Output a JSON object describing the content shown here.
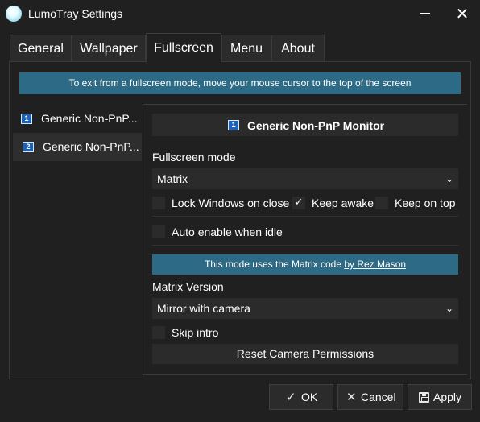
{
  "window": {
    "title": "LumoTray Settings"
  },
  "tabs": [
    {
      "label": "General"
    },
    {
      "label": "Wallpaper"
    },
    {
      "label": "Fullscreen",
      "active": true
    },
    {
      "label": "Menu"
    },
    {
      "label": "About"
    }
  ],
  "info_banner": "To exit from a fullscreen mode, move your mouse cursor to the top of the screen",
  "monitors": [
    {
      "number": "1",
      "label": "Generic Non-PnP..."
    },
    {
      "number": "2",
      "label": "Generic Non-PnP...",
      "selected": true
    }
  ],
  "detail": {
    "monitor_number": "1",
    "title": "Generic Non-PnP Monitor",
    "fullscreen_mode_label": "Fullscreen mode",
    "fullscreen_mode_value": "Matrix",
    "options": {
      "lock_windows": {
        "label": "Lock Windows on close",
        "checked": false
      },
      "keep_awake": {
        "label": "Keep awake",
        "checked": true
      },
      "keep_on_top": {
        "label": "Keep on top",
        "checked": false
      },
      "auto_enable": {
        "label": "Auto enable when idle",
        "checked": false
      }
    },
    "mode_banner": {
      "text": "This mode uses the Matrix code",
      "link": "by Rez Mason"
    },
    "matrix_version_label": "Matrix Version",
    "matrix_version_value": "Mirror with camera",
    "skip_intro": {
      "label": "Skip intro",
      "checked": false
    },
    "reset_button": "Reset Camera Permissions"
  },
  "footer": {
    "ok": "OK",
    "cancel": "Cancel",
    "apply": "Apply"
  },
  "colors": {
    "background": "#202020",
    "control": "#2b2b2b",
    "banner": "#2c6a85",
    "monitor_icon": "#1c62b8"
  },
  "icons": {
    "app": "lumotray-orb-icon",
    "minimize": "minimize-icon",
    "close": "close-icon",
    "monitor": "monitor-icon",
    "ok": "checkmark-icon",
    "cancel": "x-icon",
    "apply": "save-icon",
    "dropdown": "chevron-down-icon"
  }
}
